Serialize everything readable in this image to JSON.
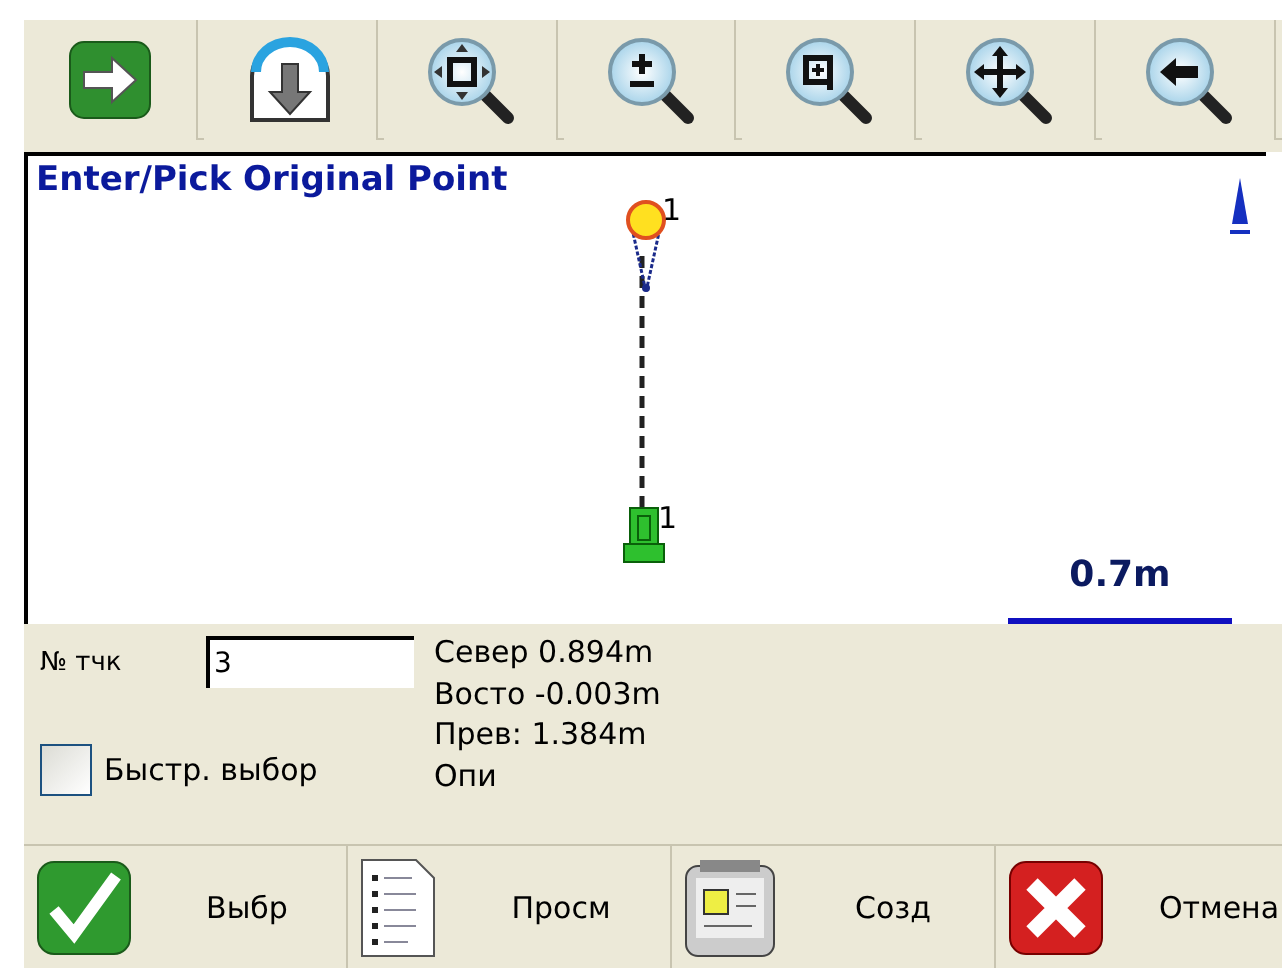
{
  "map": {
    "title": "Enter/Pick Original Point",
    "points": [
      {
        "kind": "target",
        "label": "1"
      },
      {
        "kind": "station",
        "label": "1"
      }
    ],
    "scale": "0.7m"
  },
  "point_number": {
    "label": "№ тчк",
    "value": "3"
  },
  "quick_pick": {
    "label": "Быстр. выбор",
    "checked": false
  },
  "readings": [
    "Север 0.894m",
    "Восто -0.003m",
    "Прев: 1.384m",
    "Опи"
  ],
  "buttons": [
    {
      "kind": "accept",
      "label": "Выбр"
    },
    {
      "kind": "list",
      "label": "Просм"
    },
    {
      "kind": "create",
      "label": "Созд"
    },
    {
      "kind": "cancel",
      "label": "Отмена"
    }
  ]
}
